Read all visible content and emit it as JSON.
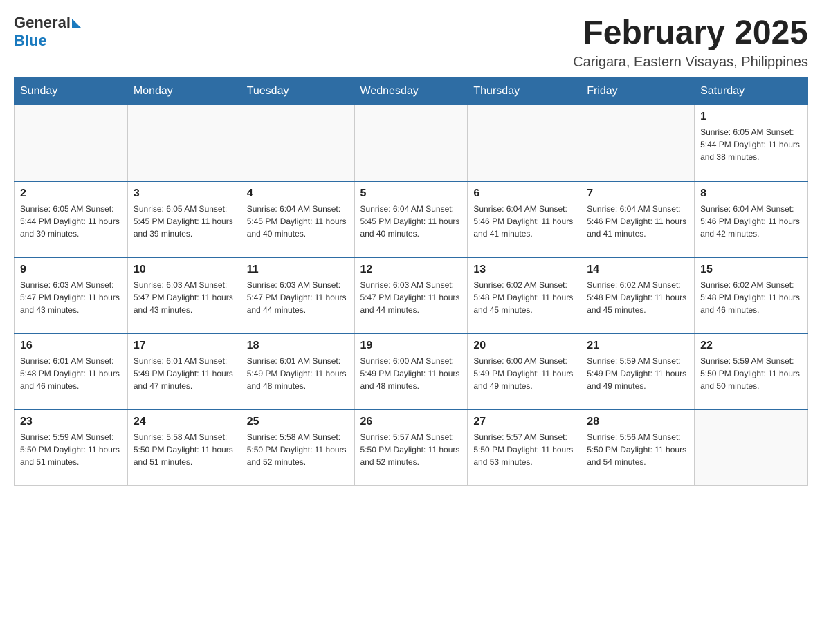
{
  "header": {
    "logo": {
      "general": "General",
      "blue": "Blue"
    },
    "title": "February 2025",
    "subtitle": "Carigara, Eastern Visayas, Philippines"
  },
  "weekdays": [
    "Sunday",
    "Monday",
    "Tuesday",
    "Wednesday",
    "Thursday",
    "Friday",
    "Saturday"
  ],
  "weeks": [
    [
      {
        "day": "",
        "info": ""
      },
      {
        "day": "",
        "info": ""
      },
      {
        "day": "",
        "info": ""
      },
      {
        "day": "",
        "info": ""
      },
      {
        "day": "",
        "info": ""
      },
      {
        "day": "",
        "info": ""
      },
      {
        "day": "1",
        "info": "Sunrise: 6:05 AM\nSunset: 5:44 PM\nDaylight: 11 hours\nand 38 minutes."
      }
    ],
    [
      {
        "day": "2",
        "info": "Sunrise: 6:05 AM\nSunset: 5:44 PM\nDaylight: 11 hours\nand 39 minutes."
      },
      {
        "day": "3",
        "info": "Sunrise: 6:05 AM\nSunset: 5:45 PM\nDaylight: 11 hours\nand 39 minutes."
      },
      {
        "day": "4",
        "info": "Sunrise: 6:04 AM\nSunset: 5:45 PM\nDaylight: 11 hours\nand 40 minutes."
      },
      {
        "day": "5",
        "info": "Sunrise: 6:04 AM\nSunset: 5:45 PM\nDaylight: 11 hours\nand 40 minutes."
      },
      {
        "day": "6",
        "info": "Sunrise: 6:04 AM\nSunset: 5:46 PM\nDaylight: 11 hours\nand 41 minutes."
      },
      {
        "day": "7",
        "info": "Sunrise: 6:04 AM\nSunset: 5:46 PM\nDaylight: 11 hours\nand 41 minutes."
      },
      {
        "day": "8",
        "info": "Sunrise: 6:04 AM\nSunset: 5:46 PM\nDaylight: 11 hours\nand 42 minutes."
      }
    ],
    [
      {
        "day": "9",
        "info": "Sunrise: 6:03 AM\nSunset: 5:47 PM\nDaylight: 11 hours\nand 43 minutes."
      },
      {
        "day": "10",
        "info": "Sunrise: 6:03 AM\nSunset: 5:47 PM\nDaylight: 11 hours\nand 43 minutes."
      },
      {
        "day": "11",
        "info": "Sunrise: 6:03 AM\nSunset: 5:47 PM\nDaylight: 11 hours\nand 44 minutes."
      },
      {
        "day": "12",
        "info": "Sunrise: 6:03 AM\nSunset: 5:47 PM\nDaylight: 11 hours\nand 44 minutes."
      },
      {
        "day": "13",
        "info": "Sunrise: 6:02 AM\nSunset: 5:48 PM\nDaylight: 11 hours\nand 45 minutes."
      },
      {
        "day": "14",
        "info": "Sunrise: 6:02 AM\nSunset: 5:48 PM\nDaylight: 11 hours\nand 45 minutes."
      },
      {
        "day": "15",
        "info": "Sunrise: 6:02 AM\nSunset: 5:48 PM\nDaylight: 11 hours\nand 46 minutes."
      }
    ],
    [
      {
        "day": "16",
        "info": "Sunrise: 6:01 AM\nSunset: 5:48 PM\nDaylight: 11 hours\nand 46 minutes."
      },
      {
        "day": "17",
        "info": "Sunrise: 6:01 AM\nSunset: 5:49 PM\nDaylight: 11 hours\nand 47 minutes."
      },
      {
        "day": "18",
        "info": "Sunrise: 6:01 AM\nSunset: 5:49 PM\nDaylight: 11 hours\nand 48 minutes."
      },
      {
        "day": "19",
        "info": "Sunrise: 6:00 AM\nSunset: 5:49 PM\nDaylight: 11 hours\nand 48 minutes."
      },
      {
        "day": "20",
        "info": "Sunrise: 6:00 AM\nSunset: 5:49 PM\nDaylight: 11 hours\nand 49 minutes."
      },
      {
        "day": "21",
        "info": "Sunrise: 5:59 AM\nSunset: 5:49 PM\nDaylight: 11 hours\nand 49 minutes."
      },
      {
        "day": "22",
        "info": "Sunrise: 5:59 AM\nSunset: 5:50 PM\nDaylight: 11 hours\nand 50 minutes."
      }
    ],
    [
      {
        "day": "23",
        "info": "Sunrise: 5:59 AM\nSunset: 5:50 PM\nDaylight: 11 hours\nand 51 minutes."
      },
      {
        "day": "24",
        "info": "Sunrise: 5:58 AM\nSunset: 5:50 PM\nDaylight: 11 hours\nand 51 minutes."
      },
      {
        "day": "25",
        "info": "Sunrise: 5:58 AM\nSunset: 5:50 PM\nDaylight: 11 hours\nand 52 minutes."
      },
      {
        "day": "26",
        "info": "Sunrise: 5:57 AM\nSunset: 5:50 PM\nDaylight: 11 hours\nand 52 minutes."
      },
      {
        "day": "27",
        "info": "Sunrise: 5:57 AM\nSunset: 5:50 PM\nDaylight: 11 hours\nand 53 minutes."
      },
      {
        "day": "28",
        "info": "Sunrise: 5:56 AM\nSunset: 5:50 PM\nDaylight: 11 hours\nand 54 minutes."
      },
      {
        "day": "",
        "info": ""
      }
    ]
  ]
}
